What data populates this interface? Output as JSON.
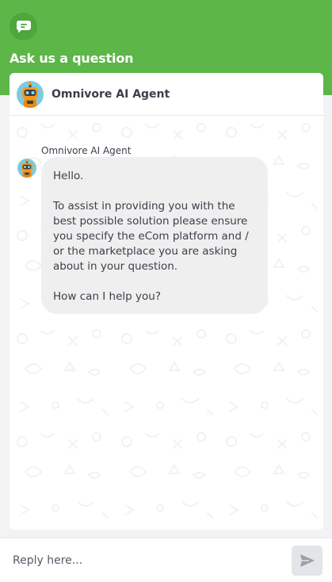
{
  "header": {
    "title": "Ask us a question",
    "logo_icon": "chat-bubble-icon",
    "color": "#5cb648"
  },
  "agent": {
    "name": "Omnivore AI Agent",
    "avatar_icon": "robot-avatar-icon"
  },
  "messages": [
    {
      "sender": "Omnivore AI Agent",
      "text": "Hello.\n\nTo assist in providing you with the best possible solution please ensure you specify the eCom platform and / or the marketplace  you are asking about in your question.\n\nHow can I help you?"
    }
  ],
  "composer": {
    "placeholder": "Reply here...",
    "send_icon": "send-icon"
  }
}
